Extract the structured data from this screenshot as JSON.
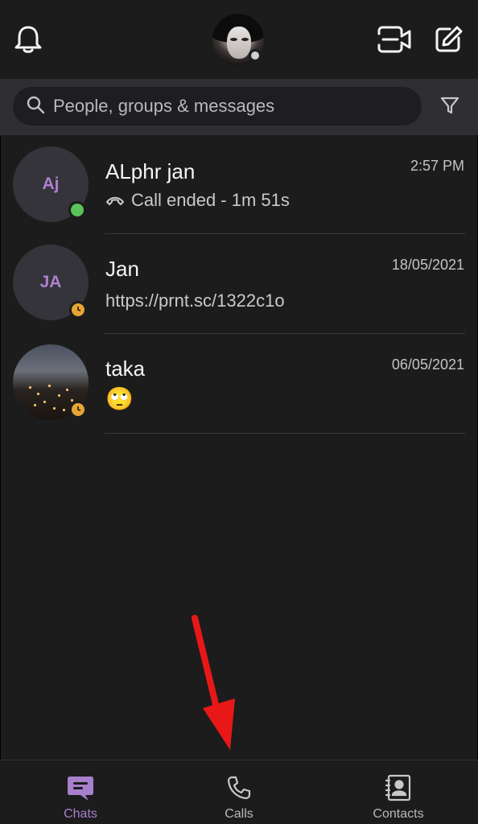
{
  "header": {
    "icons": {
      "left": "bell-icon",
      "profile": "profile-avatar",
      "video": "video-camera-icon",
      "compose": "compose-icon"
    }
  },
  "search": {
    "placeholder": "People, groups & messages",
    "icon": "search-icon",
    "filter_icon": "filter-icon"
  },
  "chats": [
    {
      "initials": "Aj",
      "name": "ALphr jan",
      "time": "2:57 PM",
      "preview": "Call ended - 1m 51s",
      "preview_icon": "call-ended-icon",
      "status": "online"
    },
    {
      "initials": "JA",
      "name": "Jan",
      "time": "18/05/2021",
      "preview": "https://prnt.sc/1322c1o",
      "status": "away"
    },
    {
      "initials": "",
      "name": "taka",
      "time": "06/05/2021",
      "preview_emoji": "🙄",
      "status": "away",
      "avatar": "city-photo"
    }
  ],
  "nav": {
    "tabs": [
      {
        "label": "Chats",
        "icon": "chat-bubble-icon",
        "active": true
      },
      {
        "label": "Calls",
        "icon": "phone-icon",
        "active": false
      },
      {
        "label": "Contacts",
        "icon": "contacts-icon",
        "active": false
      }
    ]
  },
  "colors": {
    "accent": "#a77fcc",
    "online": "#5ac35a",
    "away": "#e8a534",
    "annotation_arrow": "#e81818"
  }
}
